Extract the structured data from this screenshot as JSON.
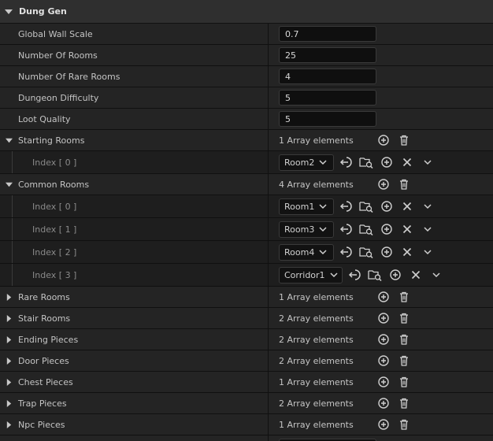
{
  "section": {
    "title": "Dung Gen"
  },
  "scalars": [
    {
      "label": "Global Wall Scale",
      "value": "0.7"
    },
    {
      "label": "Number Of Rooms",
      "value": "25"
    },
    {
      "label": "Number Of Rare Rooms",
      "value": "4"
    },
    {
      "label": "Dungeon Difficulty",
      "value": "5"
    },
    {
      "label": "Loot Quality",
      "value": "5"
    }
  ],
  "starting_rooms": {
    "label": "Starting Rooms",
    "count": "1 Array elements",
    "items": [
      {
        "index": "Index [ 0 ]",
        "value": "Room2"
      }
    ]
  },
  "common_rooms": {
    "label": "Common Rooms",
    "count": "4 Array elements",
    "items": [
      {
        "index": "Index [ 0 ]",
        "value": "Room1"
      },
      {
        "index": "Index [ 1 ]",
        "value": "Room3"
      },
      {
        "index": "Index [ 2 ]",
        "value": "Room4"
      },
      {
        "index": "Index [ 3 ]",
        "value": "Corridor1"
      }
    ]
  },
  "collapsed_arrays": [
    {
      "label": "Rare Rooms",
      "count": "1 Array elements"
    },
    {
      "label": "Stair Rooms",
      "count": "2 Array elements"
    },
    {
      "label": "Ending Pieces",
      "count": "2 Array elements"
    },
    {
      "label": "Door Pieces",
      "count": "2 Array elements"
    },
    {
      "label": "Chest Pieces",
      "count": "1 Array elements"
    },
    {
      "label": "Trap Pieces",
      "count": "2 Array elements"
    },
    {
      "label": "Npc Pieces",
      "count": "1 Array elements"
    }
  ],
  "colors": {
    "background": "#1a1a1a",
    "row": "#242424",
    "child_row": "#1e1e1e",
    "header": "#2f2f2f",
    "input": "#0f0f0f",
    "text": "#c4c4c4",
    "icon": "#cfcfcf"
  },
  "icons": {
    "expanded": "triangle-down-icon",
    "collapsed": "triangle-right-icon",
    "add": "plus-circle-icon",
    "delete": "trash-icon",
    "use_selected": "arrow-left-circle-icon",
    "browse": "folder-search-icon",
    "clear": "x-icon",
    "more": "chevron-down-icon"
  }
}
